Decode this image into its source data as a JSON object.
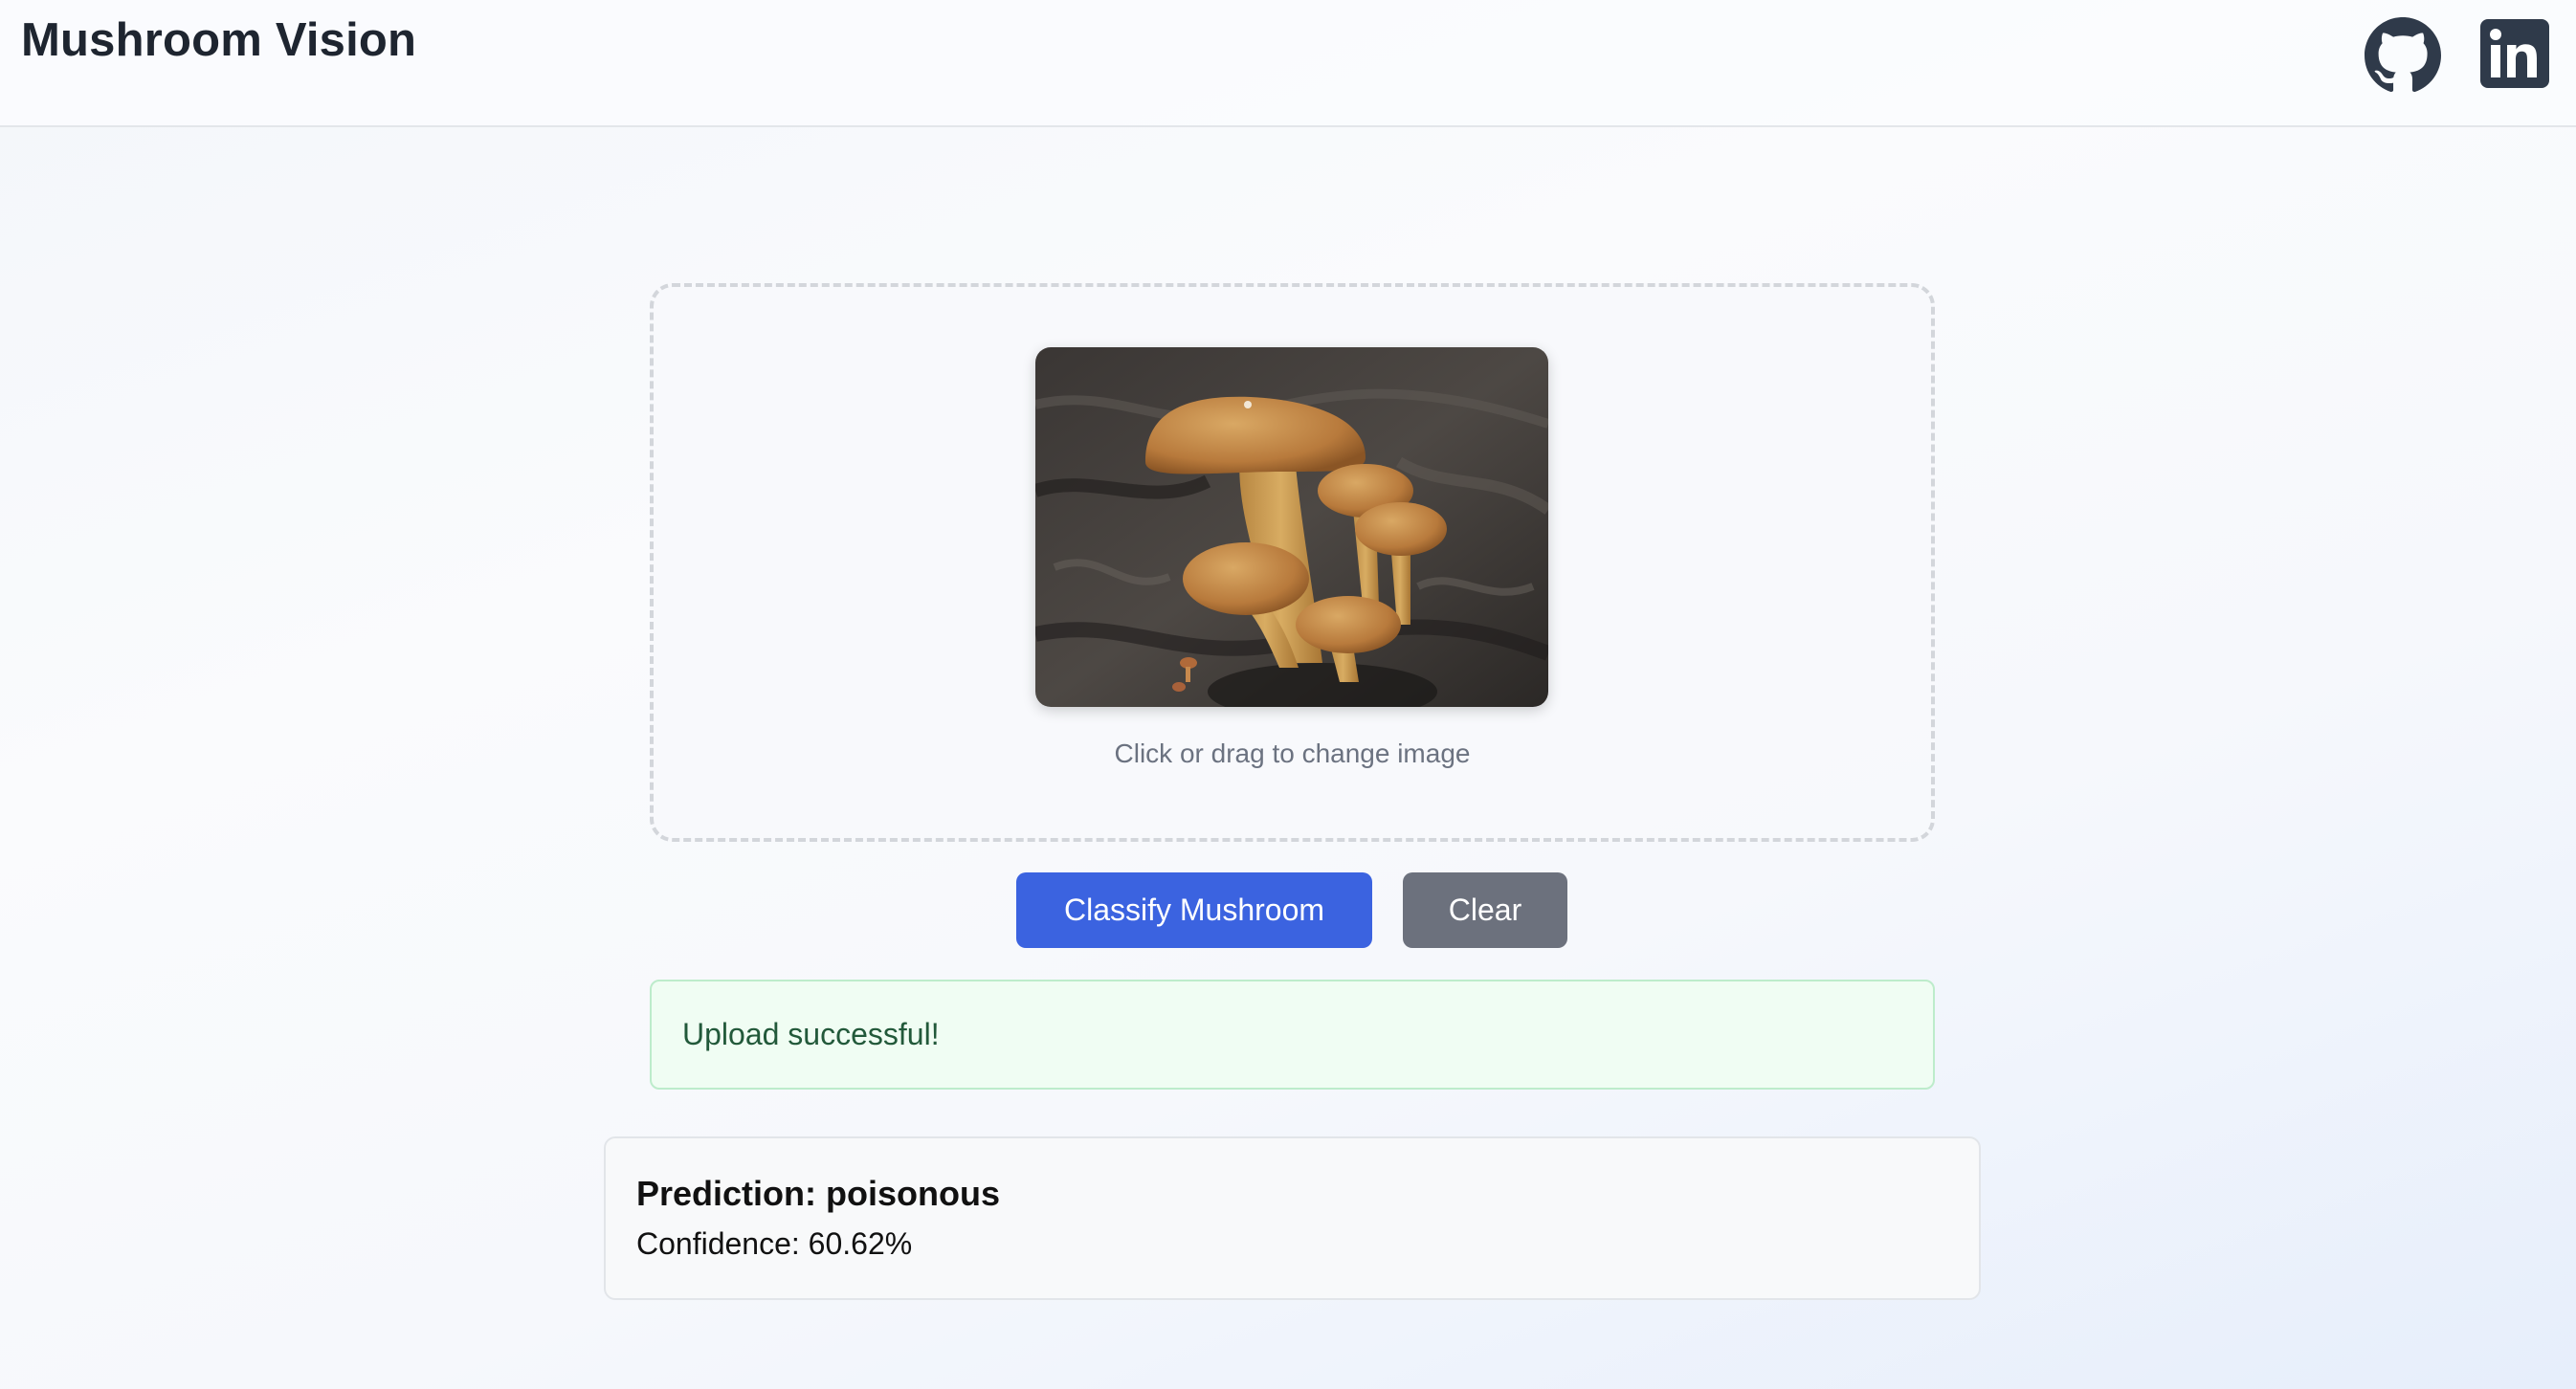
{
  "header": {
    "title": "Mushroom Vision",
    "links": [
      {
        "icon": "github-icon",
        "label": "GitHub"
      },
      {
        "icon": "linkedin-icon",
        "label": "LinkedIn"
      }
    ]
  },
  "upload": {
    "preview_alt": "Uploaded mushroom image",
    "hint": "Click or drag to change image"
  },
  "actions": {
    "classify_label": "Classify Mushroom",
    "clear_label": "Clear"
  },
  "status": {
    "message": "Upload successful!",
    "type": "success"
  },
  "result": {
    "prediction": "Prediction: poisonous",
    "confidence": "Confidence: 60.62%"
  },
  "colors": {
    "primary": "#3b63e0",
    "secondary": "#6c717d",
    "success_bg": "#f0fdf3",
    "success_text": "#22593a"
  }
}
